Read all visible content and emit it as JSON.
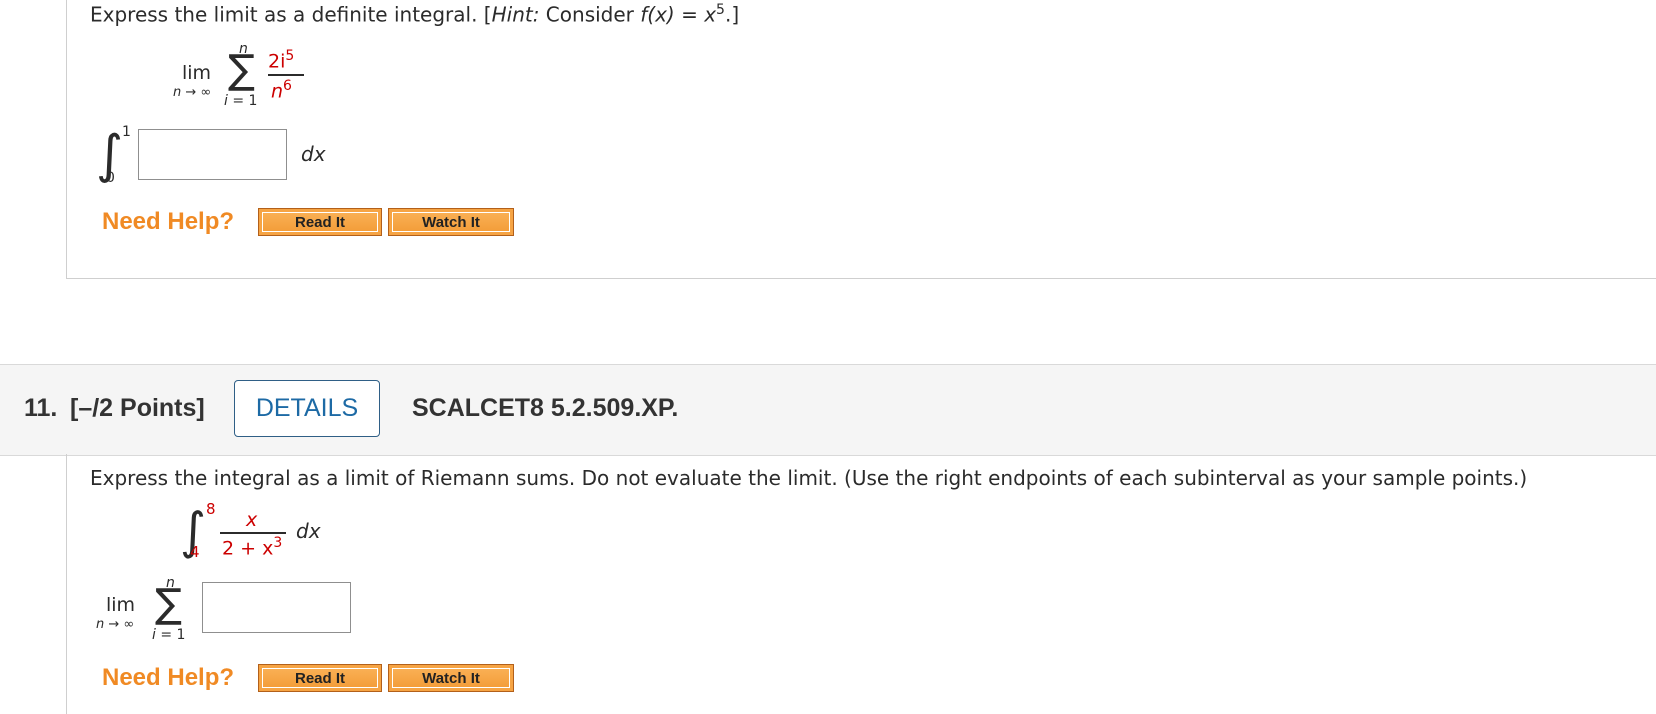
{
  "problem10": {
    "prompt_prefix": "Express the limit as a definite integral. [",
    "hint_label": "Hint:",
    "consider": " Consider ",
    "fx": "f(x) = x",
    "fx_exp": "5",
    "prompt_suffix": ".]",
    "lim": "lim",
    "lim_sub": "n → ∞",
    "sum_top": "n",
    "sum_bottom": "i = 1",
    "sigma": "∑",
    "frac_num": "2i",
    "frac_num_exp": "5",
    "frac_den": "n",
    "frac_den_exp": "6",
    "integral_sign": "∫",
    "int_upper": "1",
    "int_lower": "0",
    "dx": "dx",
    "answer_value": ""
  },
  "problem11": {
    "number": "11.",
    "points": "[–/2 Points]",
    "details_label": "DETAILS",
    "code": "SCALCET8 5.2.509.XP.",
    "prompt": "Express the integral as a limit of Riemann sums. Do not evaluate the limit. (Use the right endpoints of each subinterval as your sample points.)",
    "integral_sign": "∫",
    "int_upper": "8",
    "int_lower": "4",
    "frac_num": "x",
    "frac_den_pre": "2 + x",
    "frac_den_exp": "3",
    "dx": "dx",
    "lim": "lim",
    "lim_sub": "n → ∞",
    "sigma": "∑",
    "sum_top": "n",
    "sum_bottom": "i = 1",
    "answer_value": ""
  },
  "help": {
    "need_help": "Need Help?",
    "read_it": "Read It",
    "watch_it": "Watch It"
  }
}
